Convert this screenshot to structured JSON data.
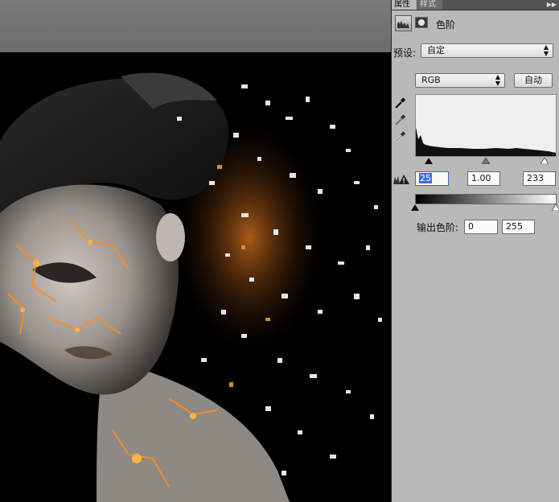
{
  "panel": {
    "tabs": [
      {
        "label": "属性",
        "active": true
      },
      {
        "label": "样式",
        "active": false
      }
    ],
    "menu_icon": "double-chevron-right-icon",
    "title": "色阶",
    "preset": {
      "label": "预设:",
      "value": "自定"
    },
    "channel": {
      "value": "RGB"
    },
    "auto_label": "自动",
    "input_levels": {
      "black": "25",
      "gamma": "1.00",
      "white": "233"
    },
    "output_levels": {
      "label": "输出色阶:",
      "black": "0",
      "white": "255"
    },
    "icons": {
      "levels": "levels-histogram-icon",
      "mask": "mask-icon",
      "eyedroppers": [
        "black-point-eyedropper-icon",
        "gray-point-eyedropper-icon",
        "white-point-eyedropper-icon"
      ],
      "clipping": "clipping-warning-icon"
    }
  },
  "colors": {
    "panel_bg": "#b9b9b9",
    "tab_bar": "#545454",
    "canvas_bg": "#000000",
    "pasteboard": "#6b6b6b",
    "selection": "#3d70d8",
    "fire": "#e8661c"
  }
}
